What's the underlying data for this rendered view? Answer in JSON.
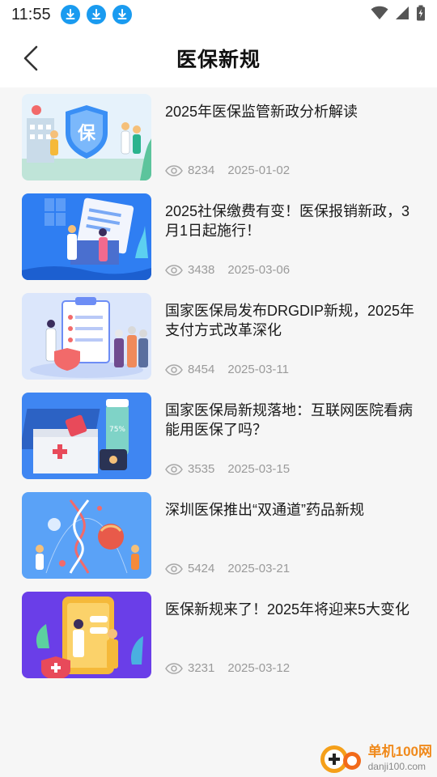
{
  "status_bar": {
    "time": "11:55",
    "download_icons": [
      "download-icon",
      "download-icon",
      "download-icon"
    ],
    "right_icons": [
      "wifi-icon",
      "signal-icon",
      "battery-icon"
    ]
  },
  "header": {
    "back_icon": "chevron-left-icon",
    "title": "医保新规"
  },
  "articles": [
    {
      "title": "2025年医保监管新政分析解读",
      "views": "8234",
      "date": "2025-01-02",
      "thumb_color": "#3a8ff5"
    },
    {
      "title": "2025社保缴费有变！医保报销新政，3月1日起施行！",
      "views": "3438",
      "date": "2025-03-06",
      "thumb_color": "#2f7ef2"
    },
    {
      "title": "国家医保局发布DRGDIP新规，2025年支付方式改革深化",
      "views": "8454",
      "date": "2025-03-11",
      "thumb_color": "#6d8df5"
    },
    {
      "title": "国家医保局新规落地：互联网医院看病能用医保了吗？",
      "views": "3535",
      "date": "2025-03-15",
      "thumb_color": "#3f86f2"
    },
    {
      "title": "深圳医保推出“双通道”药品新规",
      "views": "5424",
      "date": "2025-03-21",
      "thumb_color": "#5aa2f7"
    },
    {
      "title": "医保新规来了！2025年将迎来5大变化",
      "views": "3231",
      "date": "2025-03-12",
      "thumb_color": "#6a3ee8"
    }
  ],
  "watermark": {
    "cn": "单机100网",
    "en": "danji100.com"
  }
}
